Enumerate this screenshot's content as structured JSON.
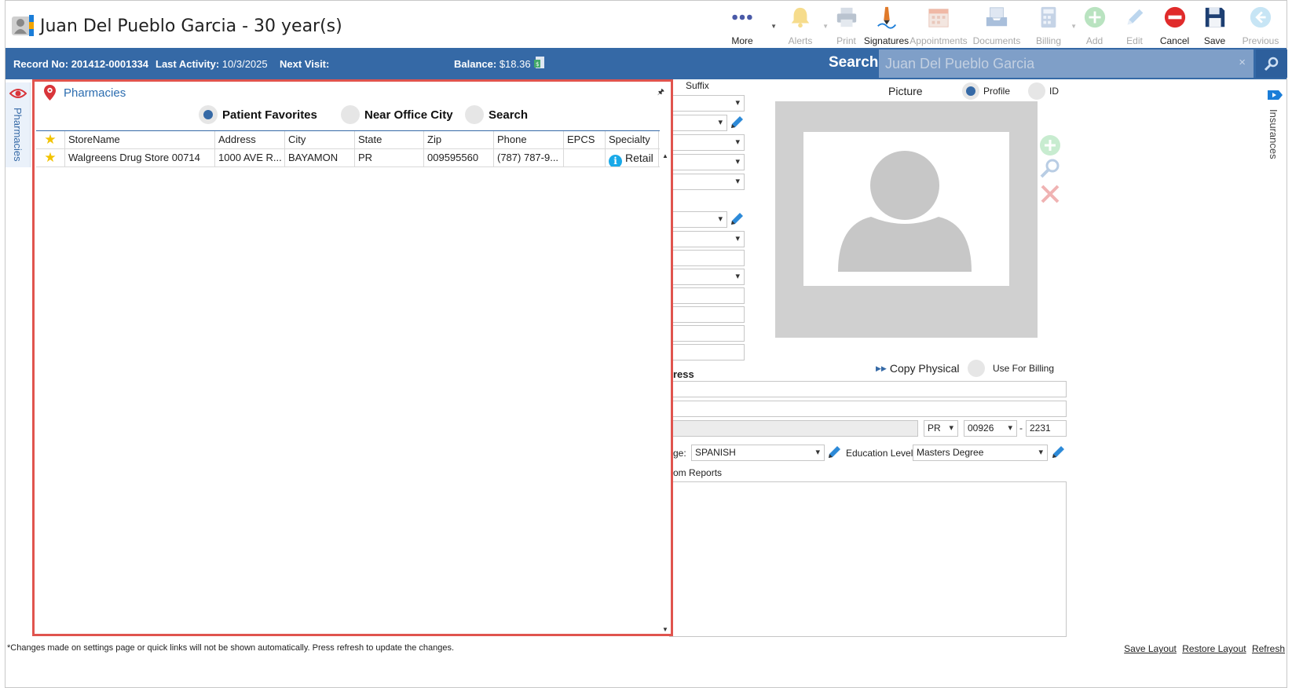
{
  "window": {
    "title": "Juan Del Pueblo Garcia - 30 year(s)"
  },
  "toolbar": {
    "items": [
      {
        "label": "More",
        "icon": "more-dots-icon",
        "enabled": true
      },
      {
        "label": "Alerts",
        "icon": "bell-icon",
        "enabled": false
      },
      {
        "label": "Print",
        "icon": "printer-icon",
        "enabled": false
      },
      {
        "label": "Signatures",
        "icon": "pen-signature-icon",
        "enabled": true
      },
      {
        "label": "Appointments",
        "icon": "calendar-icon",
        "enabled": false
      },
      {
        "label": "Documents",
        "icon": "tray-icon",
        "enabled": false
      },
      {
        "label": "Billing",
        "icon": "calculator-icon",
        "enabled": false
      },
      {
        "label": "Add",
        "icon": "add-icon",
        "enabled": false
      },
      {
        "label": "Edit",
        "icon": "pencil-icon",
        "enabled": false
      },
      {
        "label": "Cancel",
        "icon": "cancel-icon",
        "enabled": true
      },
      {
        "label": "Save",
        "icon": "floppy-icon",
        "enabled": true
      },
      {
        "label": "Previous",
        "icon": "back-arrow-icon",
        "enabled": false
      }
    ]
  },
  "infobar": {
    "record_label": "Record No:",
    "record_value": "201412-0001334",
    "activity_label": "Last Activity:",
    "activity_value": "10/3/2025",
    "next_label": "Next Visit:",
    "next_value": "",
    "balance_label": "Balance:",
    "balance_value": "$18.36",
    "search_label": "Search:",
    "search_value": "Juan Del Pueblo Garcia",
    "clear": "×"
  },
  "left_tab": {
    "label": "Pharmacies"
  },
  "right_tab": {
    "label": "Insurances"
  },
  "form": {
    "suffix_label": "Suffix",
    "picture_label": "Picture",
    "profile_label": "Profile",
    "id_label": "ID",
    "address_heading_fragment": "ress",
    "copy_physical": "Copy Physical",
    "use_for_billing": "Use For Billing",
    "state_value": "PR",
    "zip_value": "00926",
    "zip_sep": "-",
    "zip_ext": "2231",
    "language_label_fragment": "ge:",
    "language_value": "SPANISH",
    "education_label": "Education Level:",
    "education_value": "Masters Degree",
    "reports_fragment": "om Reports"
  },
  "pharmacies": {
    "title": "Pharmacies",
    "pin": "🖈",
    "mode_options": [
      {
        "label": "Patient Favorites",
        "selected": true
      },
      {
        "label": "Near Office City",
        "selected": false
      },
      {
        "label": "Search",
        "selected": false
      }
    ],
    "columns": [
      "StoreName",
      "Address",
      "City",
      "State",
      "Zip",
      "Phone",
      "EPCS",
      "Specialty"
    ],
    "rows": [
      {
        "favorite": "★",
        "StoreName": "Walgreens Drug Store 00714",
        "Address": "1000 AVE R...",
        "City": "BAYAMON",
        "State": "PR",
        "Zip": "009595560",
        "Phone": "(787) 787-9...",
        "EPCS": "",
        "Specialty": "Retail"
      }
    ],
    "header_star": "★"
  },
  "footer": {
    "note": "*Changes made on settings page or quick links will not be shown automatically. Press refresh to update the changes.",
    "links": [
      "Save Layout",
      "Restore Layout",
      "Refresh"
    ]
  },
  "colors": {
    "accent": "#3569a6",
    "panel_border": "#e0544e",
    "star": "#f2c300"
  }
}
